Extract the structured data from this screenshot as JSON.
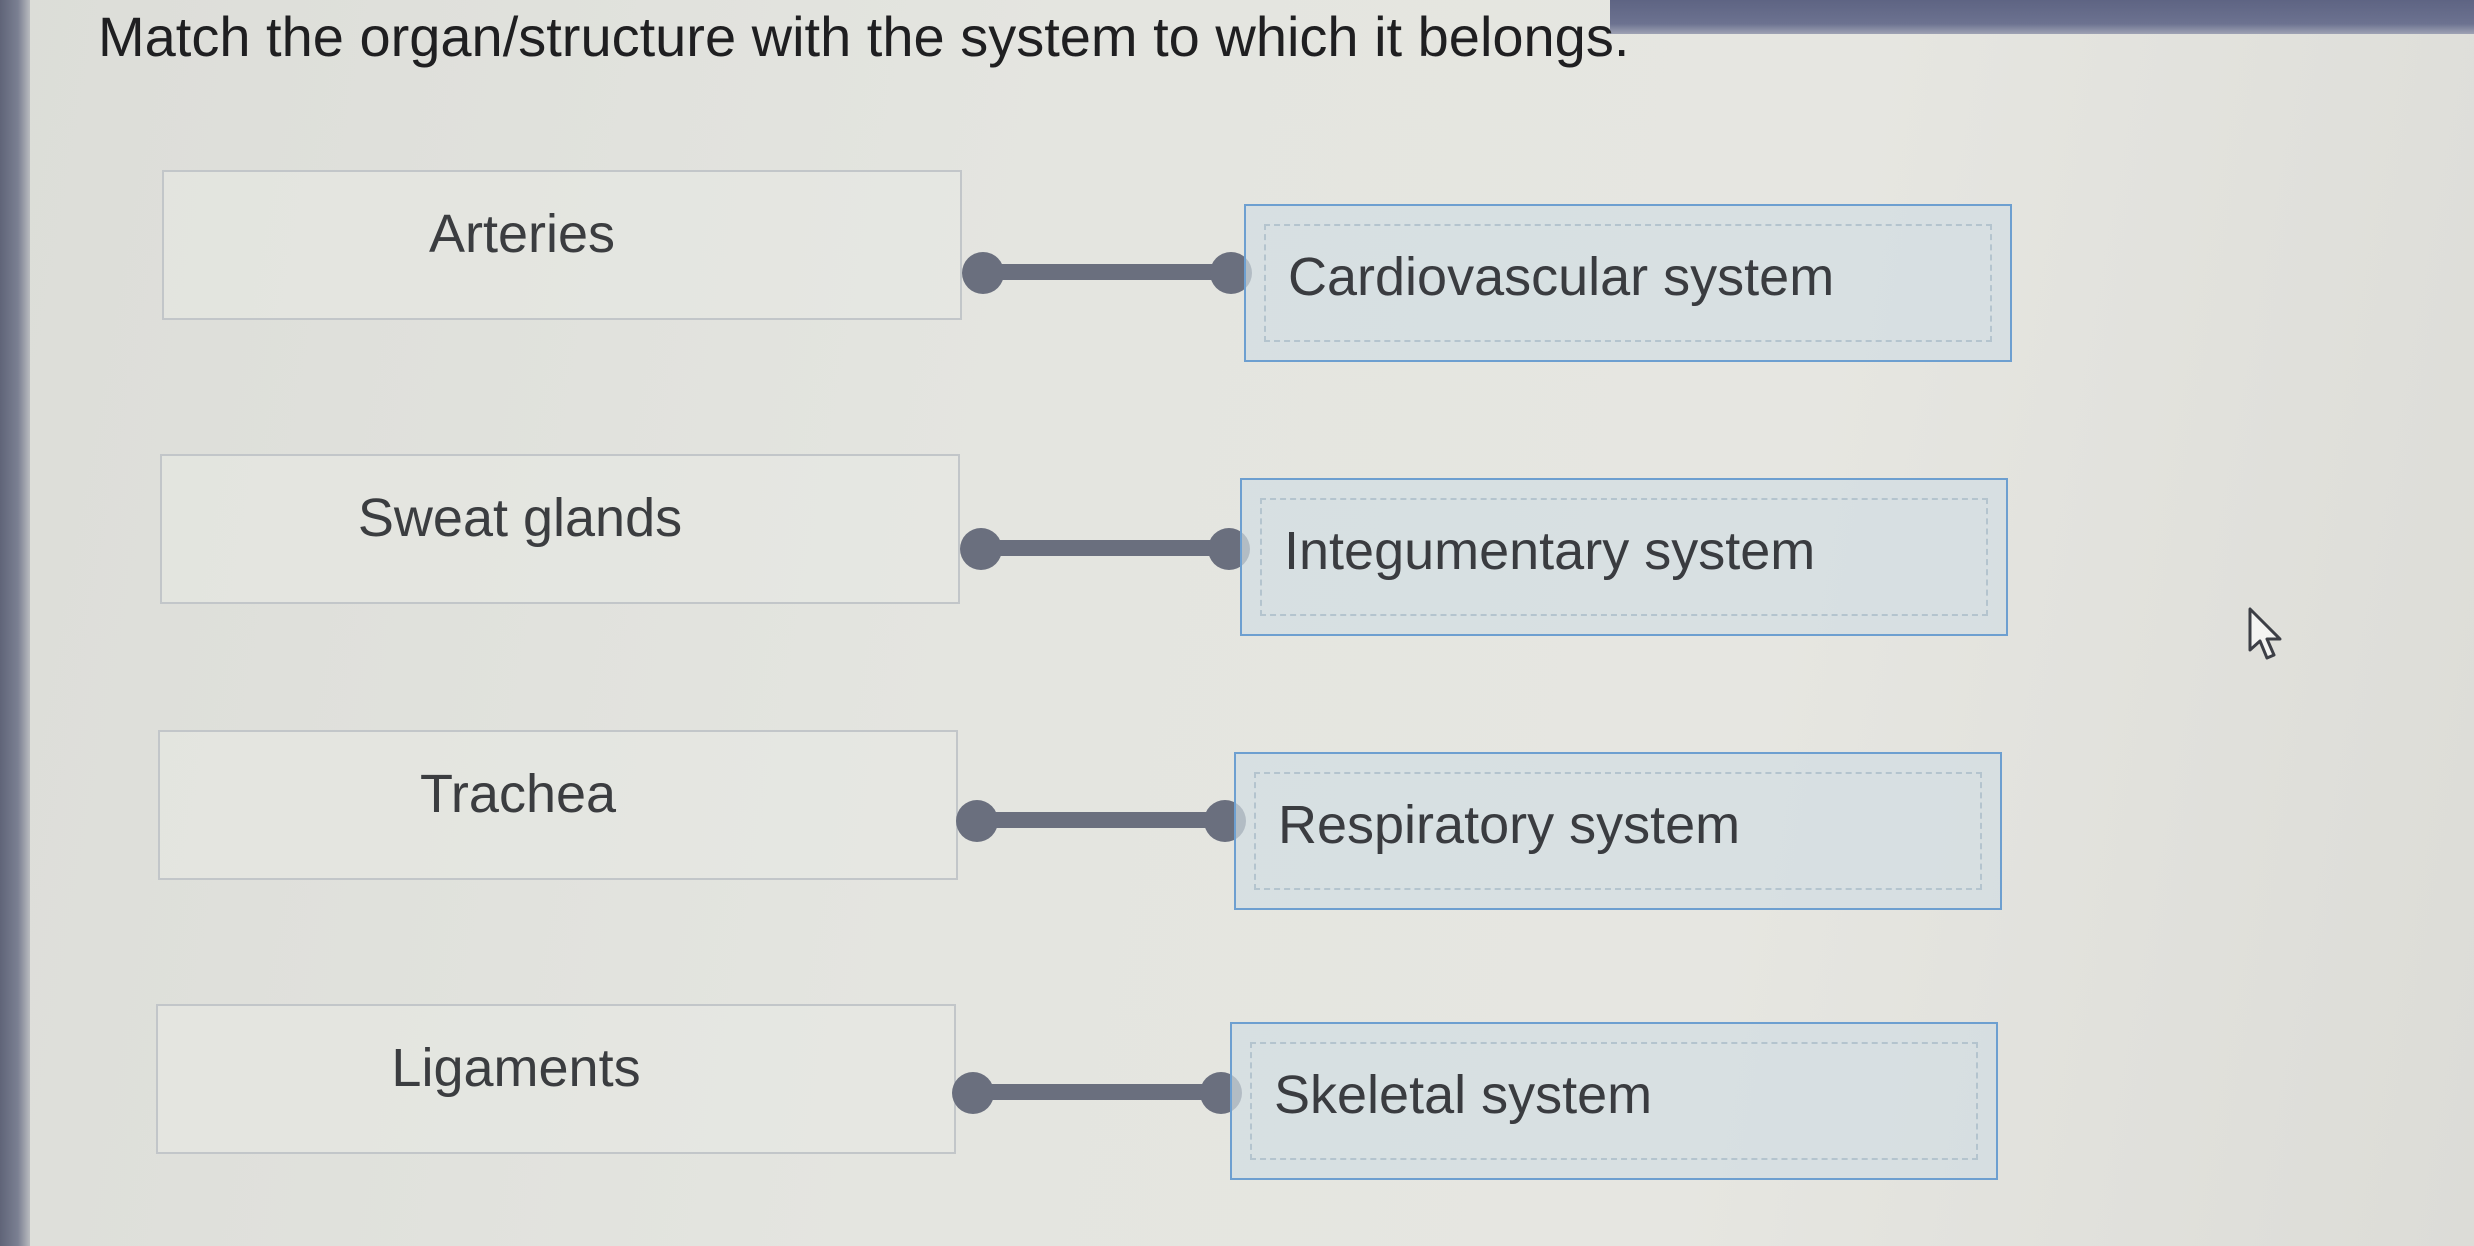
{
  "question": "Match the organ/structure with the system to which it belongs.",
  "pairs": [
    {
      "term": "Arteries",
      "answer": "Cardiovascular system"
    },
    {
      "term": "Sweat glands",
      "answer": "Integumentary system"
    },
    {
      "term": "Trachea",
      "answer": "Respiratory system"
    },
    {
      "term": "Ligaments",
      "answer": "Skeletal system"
    }
  ],
  "colors": {
    "connector": "#6a6f7e",
    "answer_border": "#6d9fd0",
    "text": "#3a3c40"
  },
  "icons": {
    "cursor": "mouse-pointer-icon"
  }
}
